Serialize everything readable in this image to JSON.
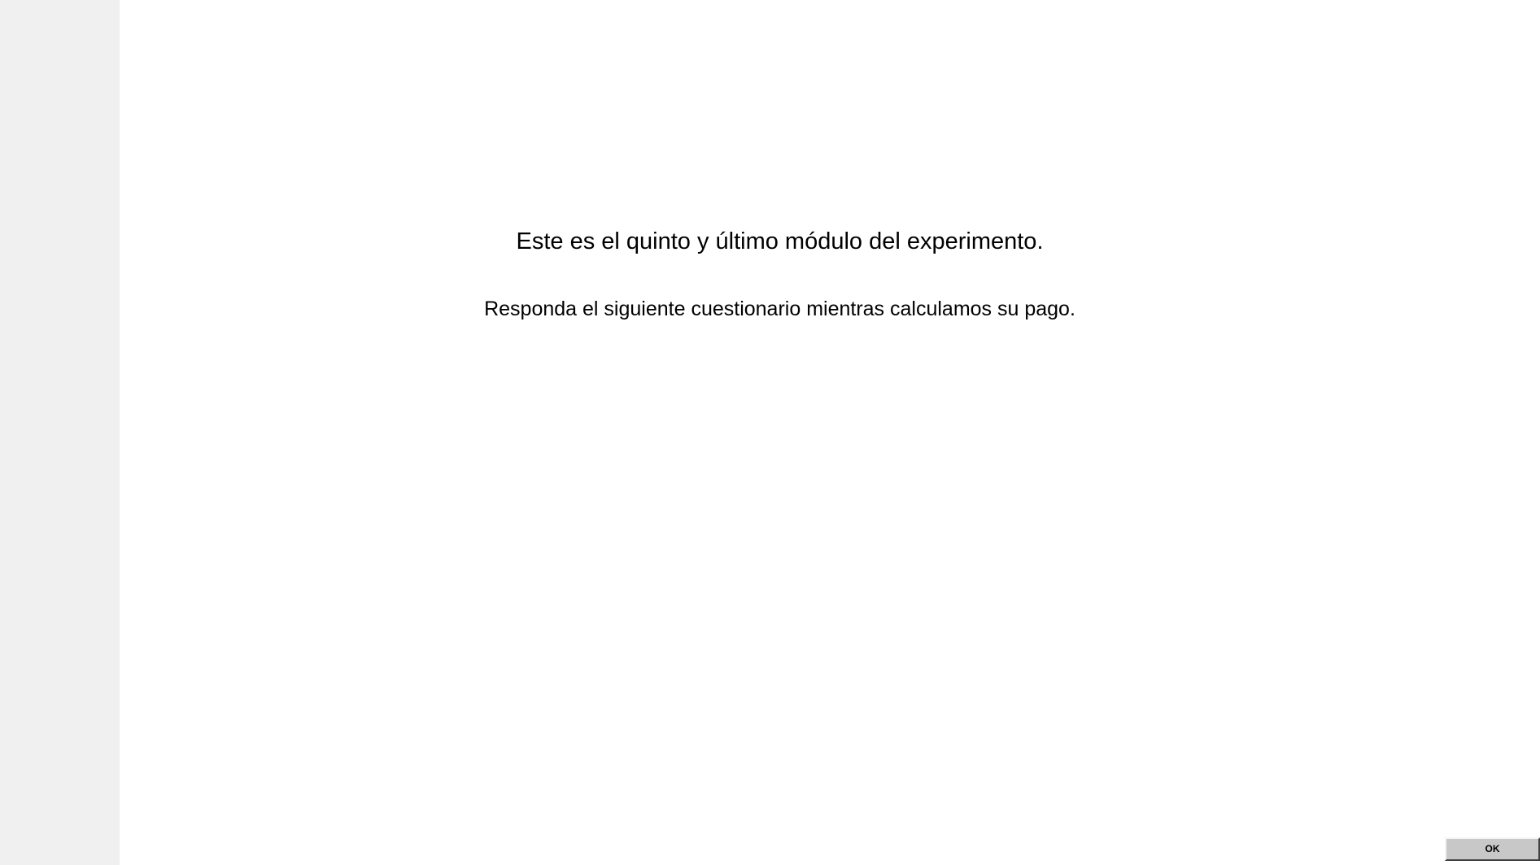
{
  "screen": {
    "heading": "Este es el quinto y último módulo del experimento.",
    "message": "Responda el siguiente cuestionario mientras calculamos su pago."
  },
  "actions": {
    "ok_label": "OK"
  },
  "colors": {
    "left_panel": "#f0f0f0",
    "background": "#ffffff",
    "button": "#c8c8c8",
    "text": "#000000"
  }
}
